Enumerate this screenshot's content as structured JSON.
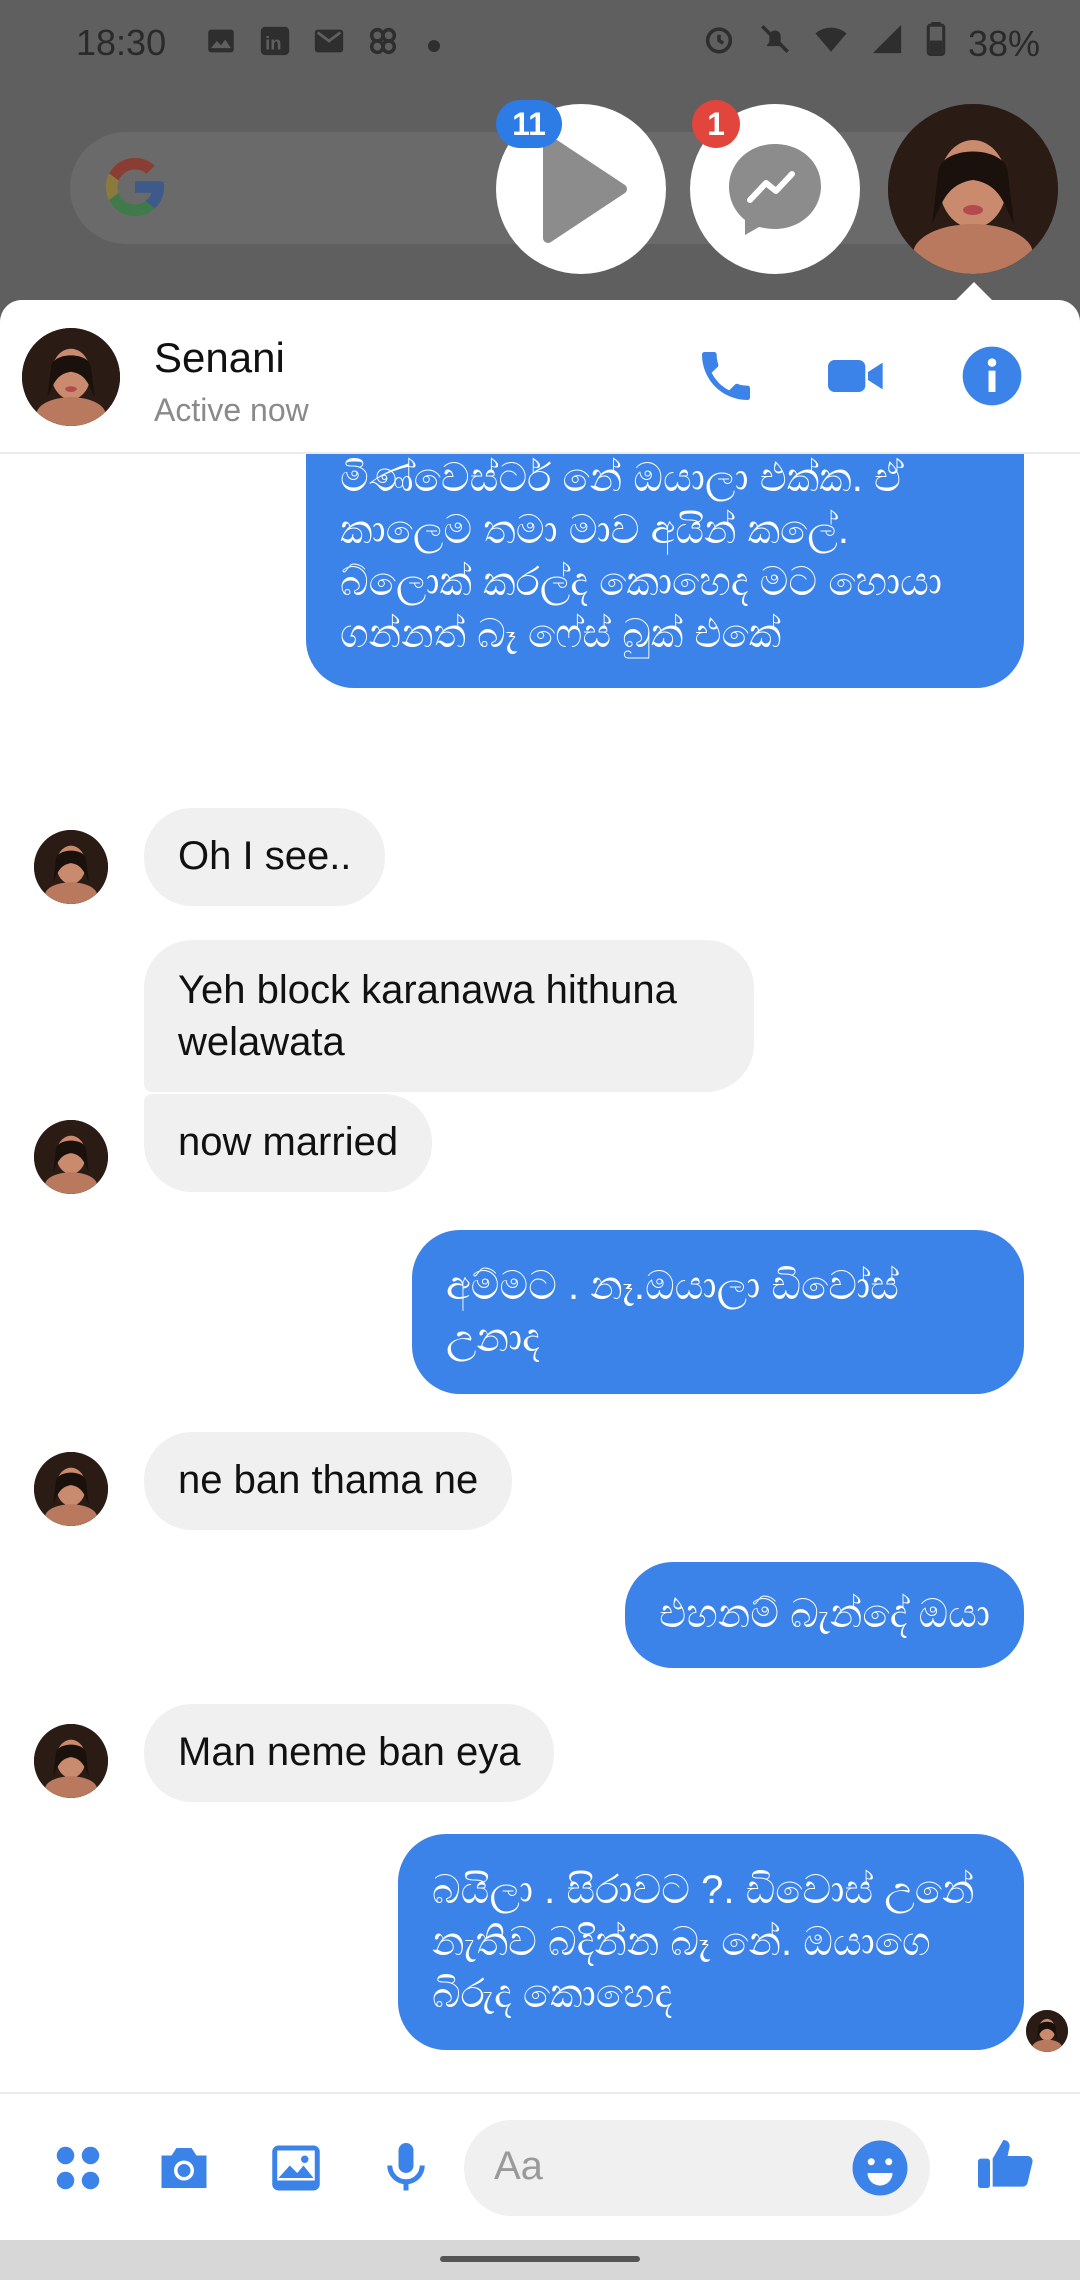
{
  "status_bar": {
    "time": "18:30",
    "battery": "38%",
    "left_icons": [
      "image-icon",
      "linkedin-icon",
      "gmail-icon",
      "app-icon"
    ],
    "right_icons": [
      "alarm-icon",
      "mute-icon",
      "wifi-icon",
      "signal-icon",
      "battery-icon"
    ]
  },
  "chat_heads": {
    "video_badge": "11",
    "messenger_badge": "1"
  },
  "header": {
    "name": "Senani",
    "status": "Active now"
  },
  "messages": [
    {
      "dir": "out",
      "text": "මිණ්වෙස්ටර් නේ ඔයාලා එක්ක. ඒ කාලෙම තමා මාව අයින් කලේ. බ්ලොක් කරල්ද කොහෙද මට හොයා ගන්නත් බෑ ෆේස් බුක් එකේ"
    },
    {
      "dir": "in",
      "text": "Oh I see.."
    },
    {
      "dir": "in",
      "text": "Yeh block karanawa hithuna welawata"
    },
    {
      "dir": "in",
      "text": "now married"
    },
    {
      "dir": "out",
      "text": "අම්මට . නෑ.ඔයාලා ඩිවෝස් උනාද"
    },
    {
      "dir": "in",
      "text": "ne ban thama ne"
    },
    {
      "dir": "out",
      "text": "එහනම් බැන්දේ ඔයා"
    },
    {
      "dir": "in",
      "text": "Man neme ban eya"
    },
    {
      "dir": "out",
      "text": "බයිලා . සිරාවට ?. ඩිවොස් උනේ නැතිව බදින්න බෑ නේ. ඔයාගෙ බිරුද කොහෙද"
    }
  ],
  "composer": {
    "placeholder": "Aa"
  },
  "colors": {
    "accent": "#3c83e9",
    "incoming_bg": "#f0f0f0",
    "badge_red": "#e1453b",
    "badge_blue": "#2d7be5"
  }
}
